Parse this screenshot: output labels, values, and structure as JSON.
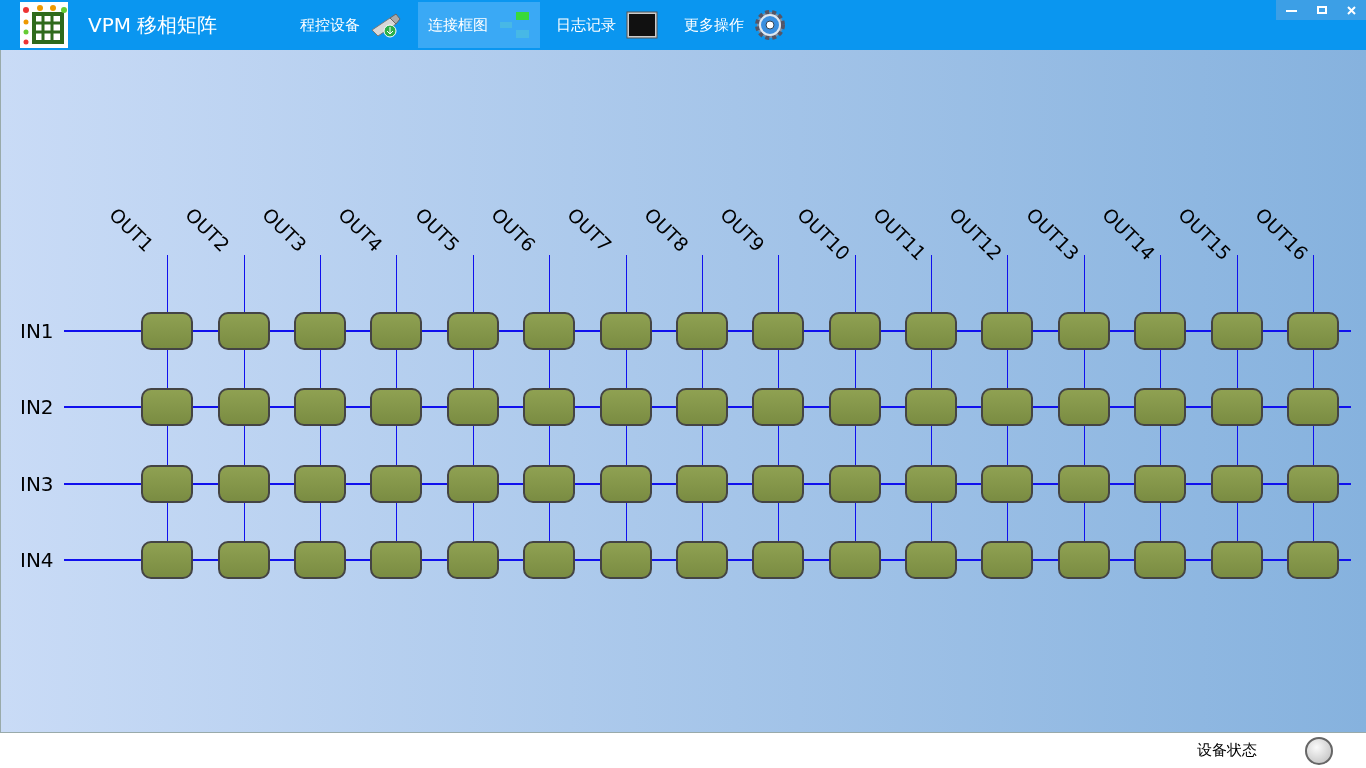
{
  "window": {
    "title": "VPM 移相矩阵"
  },
  "nav": [
    {
      "label": "程控设备",
      "kind": "device",
      "selected": false
    },
    {
      "label": "连接框图",
      "kind": "diagram",
      "selected": true
    },
    {
      "label": "日志记录",
      "kind": "log",
      "selected": false
    },
    {
      "label": "更多操作",
      "kind": "settings",
      "selected": false
    }
  ],
  "matrix": {
    "outputs": [
      "OUT1",
      "OUT2",
      "OUT3",
      "OUT4",
      "OUT5",
      "OUT6",
      "OUT7",
      "OUT8",
      "OUT9",
      "OUT10",
      "OUT11",
      "OUT12",
      "OUT13",
      "OUT14",
      "OUT15",
      "OUT16"
    ],
    "inputs": [
      "IN1",
      "IN2",
      "IN3",
      "IN4"
    ]
  },
  "status_bar": {
    "label": "设备状态",
    "on": false
  }
}
